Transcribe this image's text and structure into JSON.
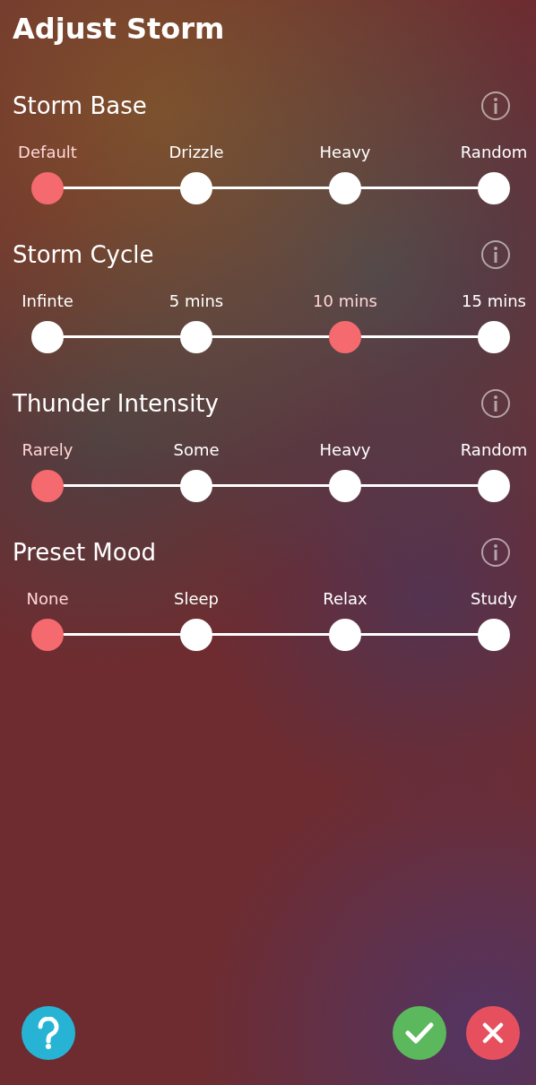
{
  "title": "Adjust Storm",
  "sections": [
    {
      "title": "Storm Base",
      "options": [
        {
          "label": "Default",
          "selected": true
        },
        {
          "label": "Drizzle",
          "selected": false
        },
        {
          "label": "Heavy",
          "selected": false
        },
        {
          "label": "Random",
          "selected": false
        }
      ]
    },
    {
      "title": "Storm Cycle",
      "options": [
        {
          "label": "Infinte",
          "selected": false
        },
        {
          "label": "5  mins",
          "selected": false
        },
        {
          "label": "10  mins",
          "selected": true
        },
        {
          "label": "15  mins",
          "selected": false
        }
      ]
    },
    {
      "title": "Thunder Intensity",
      "options": [
        {
          "label": "Rarely",
          "selected": true
        },
        {
          "label": "Some",
          "selected": false
        },
        {
          "label": "Heavy",
          "selected": false
        },
        {
          "label": "Random",
          "selected": false
        }
      ]
    },
    {
      "title": "Preset Mood",
      "options": [
        {
          "label": "None",
          "selected": true
        },
        {
          "label": "Sleep",
          "selected": false
        },
        {
          "label": "Relax",
          "selected": false
        },
        {
          "label": "Study",
          "selected": false
        }
      ]
    }
  ]
}
